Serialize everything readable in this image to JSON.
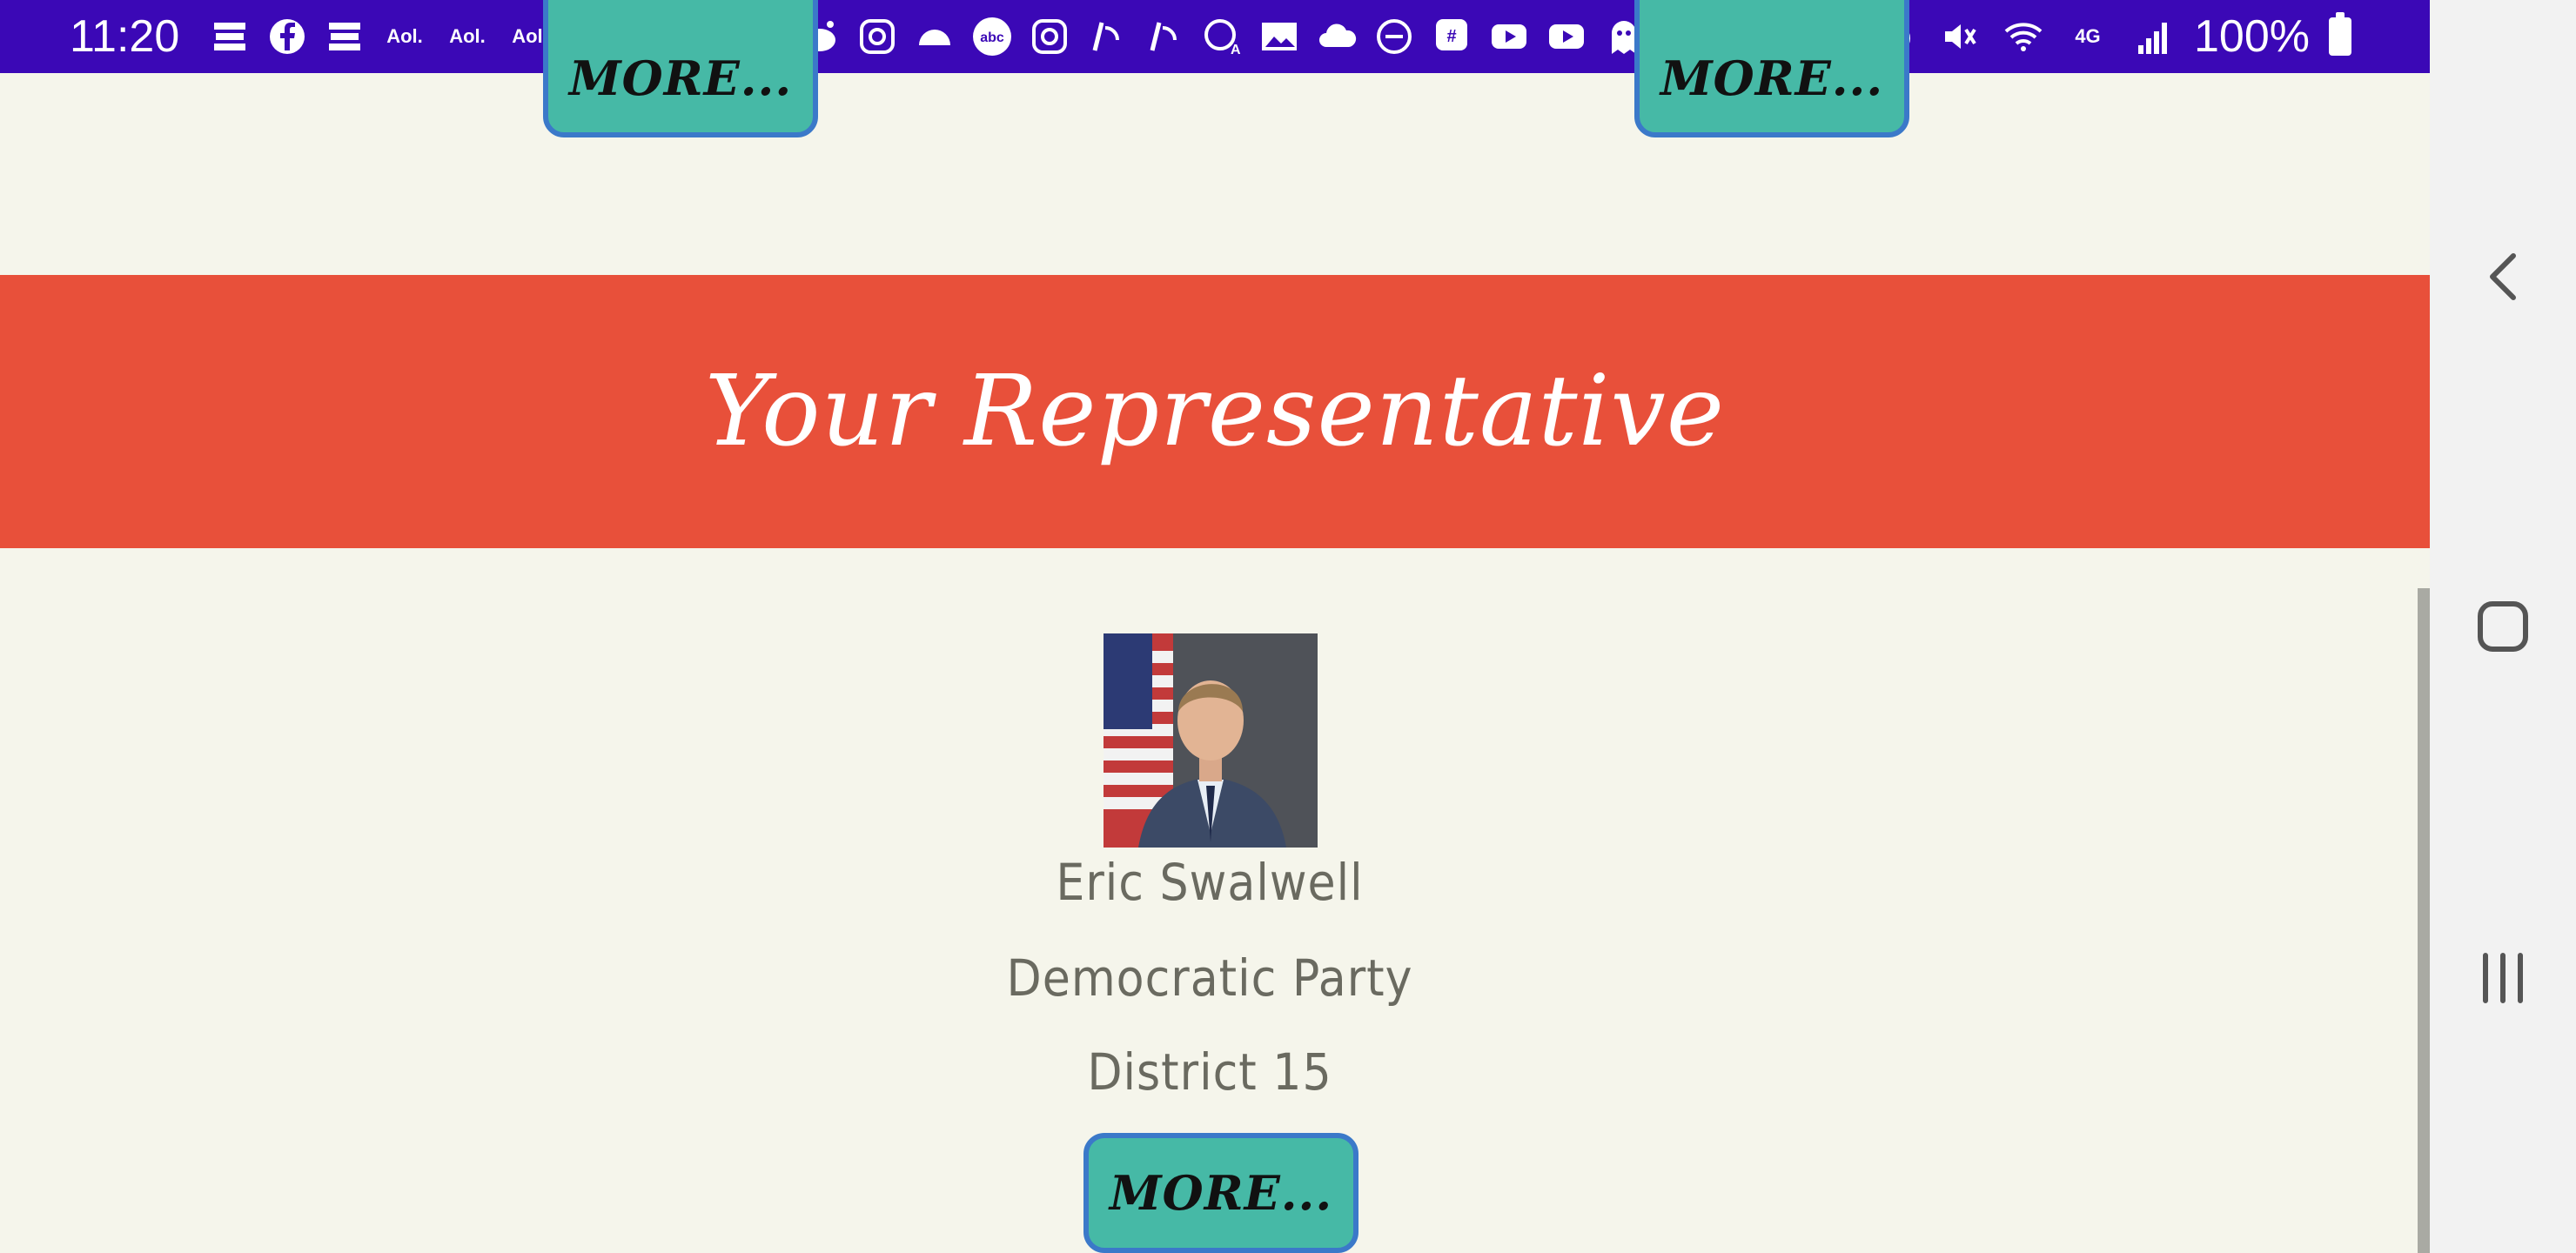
{
  "status_bar": {
    "time": "11:20",
    "aol_label": "Aol.",
    "battery_percent": "100%",
    "network_label": "4G"
  },
  "top_buttons": {
    "left_label": "MORE...",
    "right_label": "MORE..."
  },
  "section": {
    "title": "Your Representative"
  },
  "representative": {
    "name": "Eric Swalwell",
    "party": "Democratic Party",
    "district": "District 15",
    "more_label": "MORE..."
  },
  "colors": {
    "status_bar": "#3b08b6",
    "banner": "#e8503a",
    "button": "#46b9a6",
    "button_border": "#3b79c9",
    "page_bg": "#f5f5eb"
  }
}
